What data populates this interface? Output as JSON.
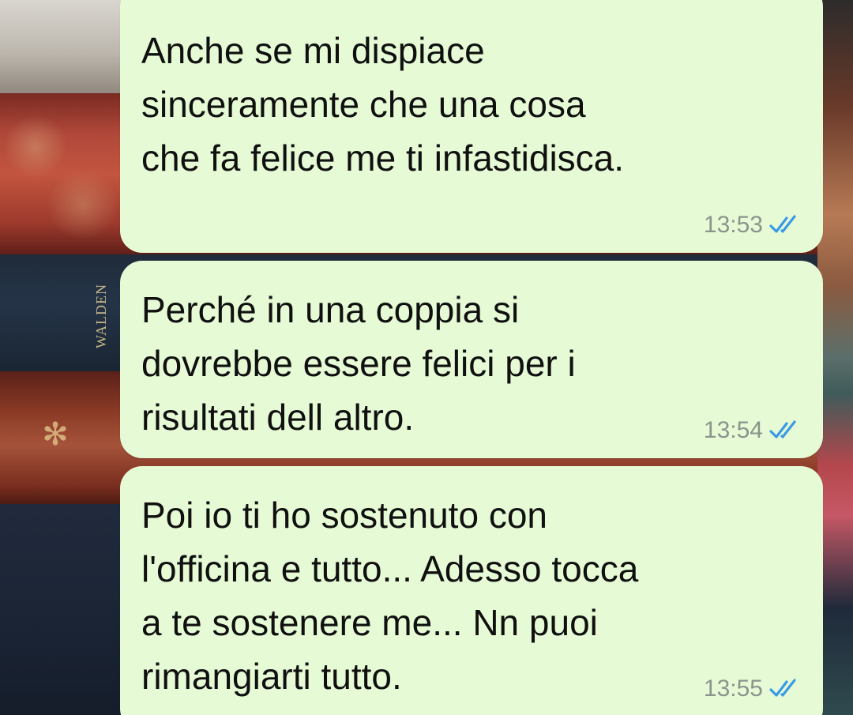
{
  "wallpaper": {
    "spine_text": "WALDEN"
  },
  "messages": [
    {
      "text": "Anche se mi dispiace\nsinceramente che una cosa\nche fa felice me ti infastidisca.",
      "time": "13:53",
      "status": "read",
      "tick_icon": "double-check-icon",
      "tick_color": "#3b9ae6"
    },
    {
      "text": "Perché in una coppia si\ndovrebbe essere felici per i\nrisultati dell altro.",
      "time": "13:54",
      "status": "read",
      "tick_icon": "double-check-icon",
      "tick_color": "#3b9ae6"
    },
    {
      "text": "Poi io ti ho sostenuto con\nl'officina e tutto... Adesso tocca\na te sostenere me... Nn puoi\nrimangiarti tutto.",
      "time": "13:55",
      "status": "read",
      "tick_icon": "double-check-icon",
      "tick_color": "#3b9ae6"
    }
  ],
  "colors": {
    "bubble_background": "#e6fbd5",
    "message_text": "#101010",
    "timestamp": "#8a938c"
  }
}
